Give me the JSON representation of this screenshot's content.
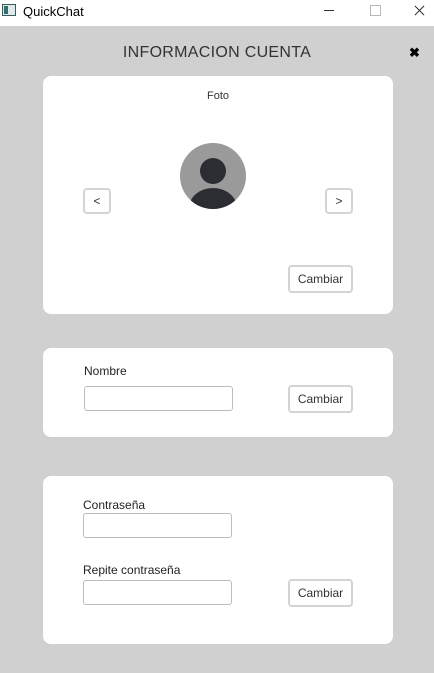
{
  "window": {
    "app_title": "QuickChat",
    "app_icon": "app-window-icon"
  },
  "header": {
    "title": "INFORMACION CUENTA",
    "close_symbol": "✖"
  },
  "photo_section": {
    "label": "Foto",
    "prev_label": "<",
    "next_label": ">",
    "change_label": "Cambiar",
    "avatar_icon": "user-avatar-icon"
  },
  "name_section": {
    "label": "Nombre",
    "value": "",
    "change_label": "Cambiar"
  },
  "password_section": {
    "password_label": "Contraseña",
    "password_value": "",
    "repeat_label": "Repite contraseña",
    "repeat_value": "",
    "change_label": "Cambiar"
  },
  "colors": {
    "background": "#d0d0d0",
    "card": "#ffffff",
    "avatar_bg": "#9a9a9a",
    "avatar_fg": "#2b2d33"
  }
}
